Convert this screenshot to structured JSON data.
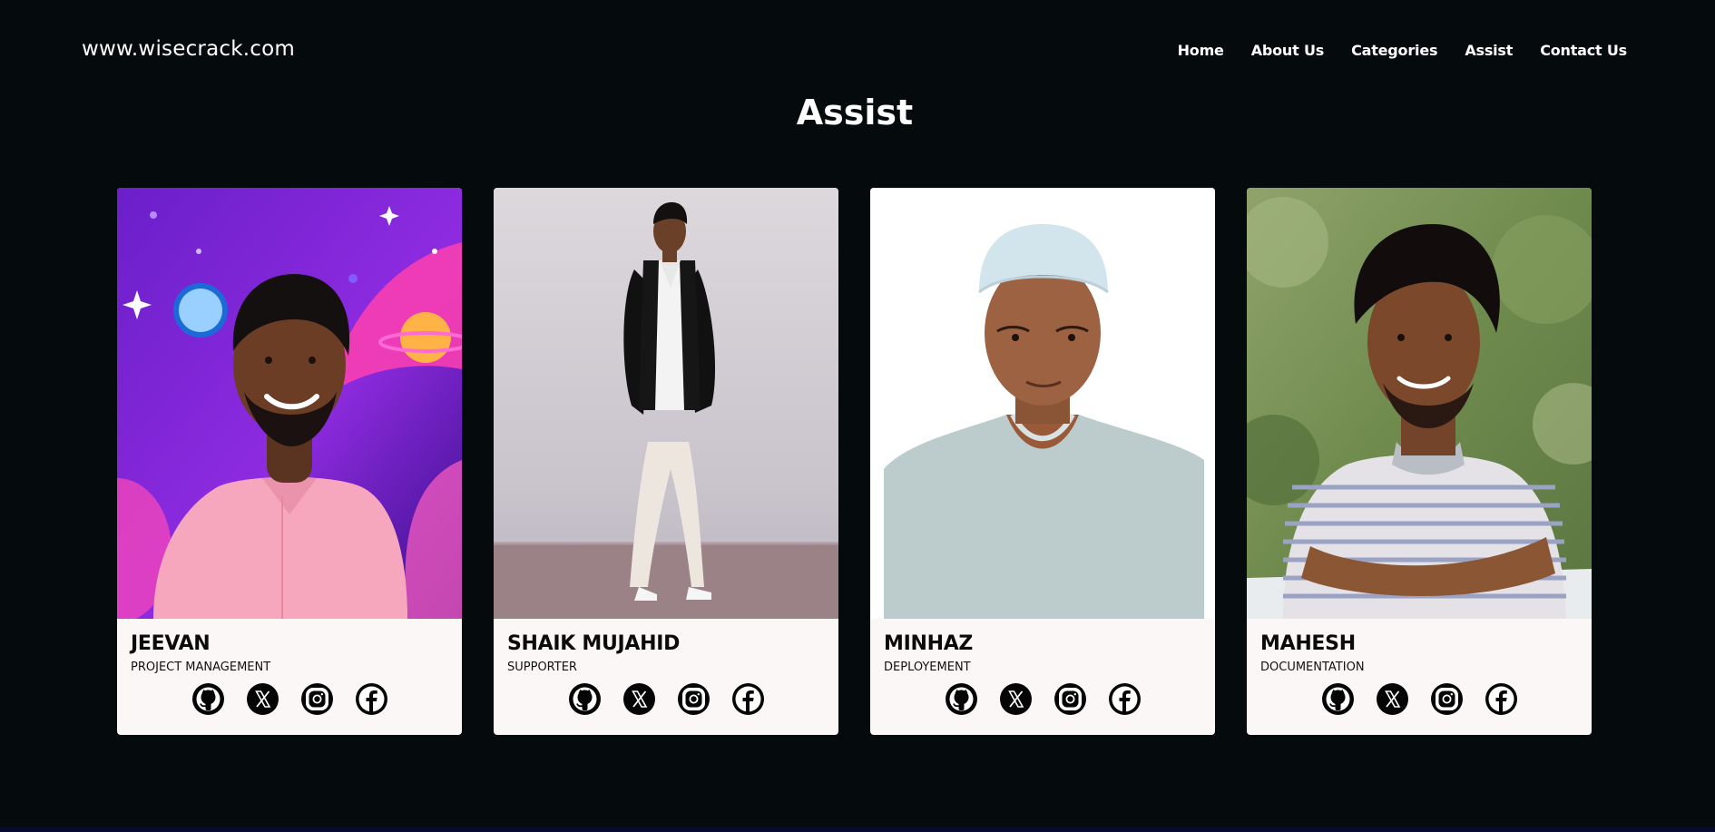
{
  "header": {
    "brand": "www.wisecrack.com",
    "nav": [
      {
        "label": "Home"
      },
      {
        "label": "About Us"
      },
      {
        "label": "Categories"
      },
      {
        "label": "Assist"
      },
      {
        "label": "Contact Us"
      }
    ]
  },
  "main": {
    "title": "Assist",
    "members": [
      {
        "name": "JEEVAN",
        "role": "PROJECT MANAGEMENT",
        "socials": [
          "github-icon",
          "x-icon",
          "instagram-icon",
          "facebook-icon"
        ]
      },
      {
        "name": "SHAIK MUJAHID",
        "role": "SUPPORTER",
        "socials": [
          "github-icon",
          "x-icon",
          "instagram-icon",
          "facebook-icon"
        ]
      },
      {
        "name": "MINHAZ",
        "role": "DEPLOYEMENT",
        "socials": [
          "github-icon",
          "x-icon",
          "instagram-icon",
          "facebook-icon"
        ]
      },
      {
        "name": "MAHESH",
        "role": "DOCUMENTATION",
        "socials": [
          "github-icon",
          "x-icon",
          "instagram-icon",
          "facebook-icon"
        ]
      }
    ]
  },
  "colors": {
    "page_background": "#050b0c",
    "card_background": "#fcf7f7",
    "text_light": "#ffffff",
    "text_dark": "#0b0b0b",
    "icon_background": "#050505"
  }
}
